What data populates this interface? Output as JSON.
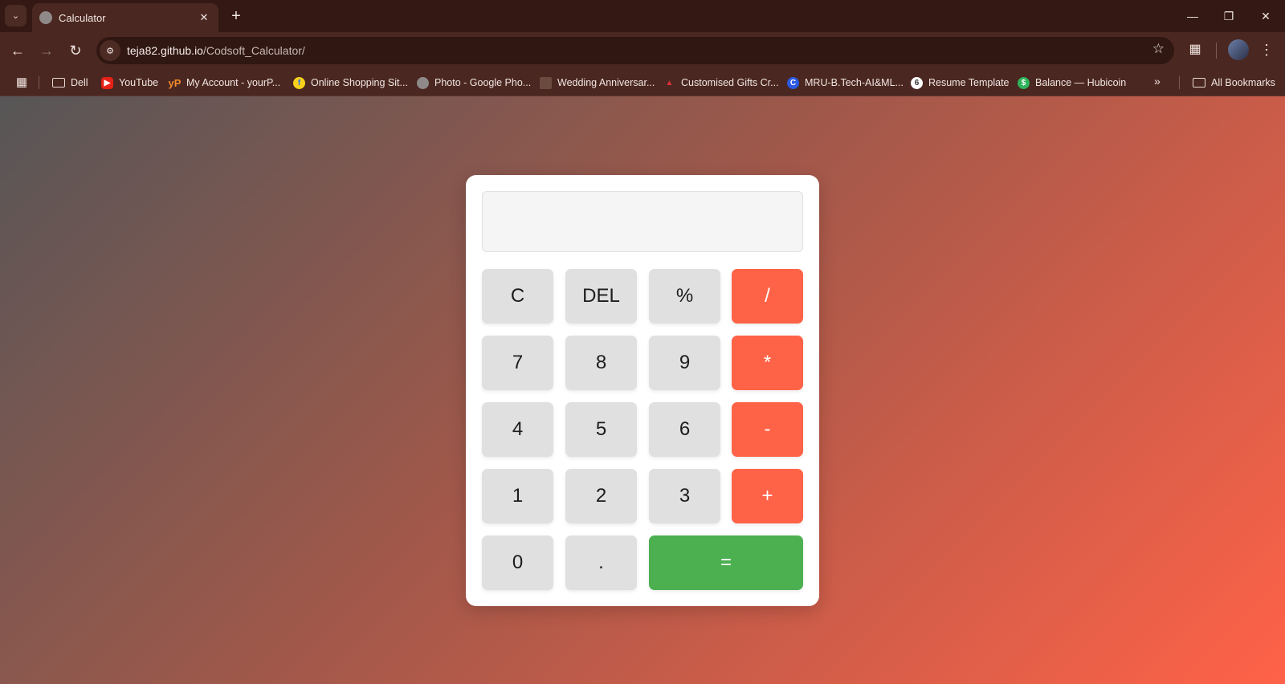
{
  "browser": {
    "tab_title": "Calculator",
    "url_host": "teja82.github.io",
    "url_path": "/Codsoft_Calculator/",
    "bookmarks": [
      {
        "label": "Dell",
        "icon": "folder-icon"
      },
      {
        "label": "YouTube",
        "icon": "youtube-icon"
      },
      {
        "label": "My Account - yourP...",
        "icon": "yourpage-icon"
      },
      {
        "label": "Online Shopping Sit...",
        "icon": "flipkart-icon"
      },
      {
        "label": "Photo - Google Pho...",
        "icon": "globe-icon"
      },
      {
        "label": "Wedding Anniversar...",
        "icon": "wedding-icon"
      },
      {
        "label": "Customised Gifts Cr...",
        "icon": "gift-icon"
      },
      {
        "label": "MRU-B.Tech-AI&ML...",
        "icon": "c-icon"
      },
      {
        "label": "Resume Template",
        "icon": "resume-icon"
      },
      {
        "label": "Balance — Hubicoin",
        "icon": "hubicoin-icon"
      }
    ],
    "all_bookmarks": "All Bookmarks"
  },
  "calculator": {
    "display_value": "",
    "keys": {
      "clear": "C",
      "delete": "DEL",
      "percent": "%",
      "divide": "/",
      "seven": "7",
      "eight": "8",
      "nine": "9",
      "multiply": "*",
      "four": "4",
      "five": "5",
      "six": "6",
      "subtract": "-",
      "one": "1",
      "two": "2",
      "three": "3",
      "add": "+",
      "zero": "0",
      "decimal": ".",
      "equals": "="
    },
    "colors": {
      "operator": "#ff6347",
      "equals": "#4caf50",
      "number": "#e0e0e0"
    }
  }
}
